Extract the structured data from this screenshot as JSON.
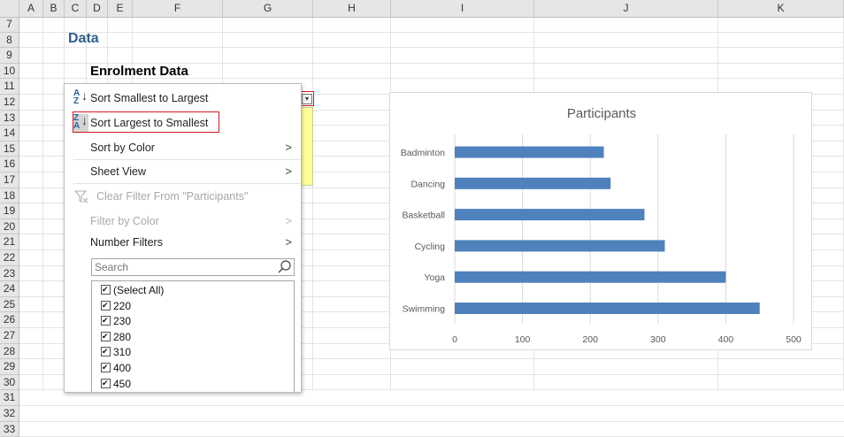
{
  "columns": [
    "A",
    "B",
    "C",
    "D",
    "E",
    "F",
    "G",
    "H",
    "I",
    "J",
    "K"
  ],
  "rows": [
    "7",
    "8",
    "9",
    "10",
    "11",
    "12",
    "13",
    "14",
    "15",
    "16",
    "17",
    "18",
    "19",
    "20",
    "21",
    "22",
    "23",
    "24",
    "25",
    "26",
    "27",
    "28",
    "29",
    "30",
    "31",
    "32",
    "33"
  ],
  "sheet": {
    "heading": "Data",
    "subheading": "Enrolment Data"
  },
  "menu": {
    "sort_asc": "Sort Smallest to Largest",
    "sort_desc": "Sort Largest to Smallest",
    "sort_by_color": "Sort by Color",
    "sheet_view": "Sheet View",
    "clear_filter": "Clear Filter From \"Participants\"",
    "filter_by_color": "Filter by Color",
    "number_filters": "Number Filters",
    "search_placeholder": "Search",
    "items": [
      "(Select All)",
      "220",
      "230",
      "280",
      "310",
      "400",
      "450"
    ]
  },
  "icons": {
    "sort_asc": "sort-ascending-icon",
    "sort_desc": "sort-descending-icon",
    "clear_filter": "clear-filter-icon",
    "search": "search-icon",
    "submenu": "chevron-right-icon"
  },
  "colors": {
    "bar": "#4f81bd",
    "highlight": "#d0191f",
    "heading": "#2e5d8a"
  },
  "chart_data": {
    "type": "bar",
    "orientation": "horizontal",
    "title": "Participants",
    "categories": [
      "Swimming",
      "Yoga",
      "Cycling",
      "Basketball",
      "Dancing",
      "Badminton"
    ],
    "values": [
      450,
      400,
      310,
      280,
      230,
      220
    ],
    "xlim": [
      0,
      500
    ],
    "ticks": [
      "0",
      "100",
      "200",
      "300",
      "400",
      "500"
    ],
    "grid": true
  }
}
